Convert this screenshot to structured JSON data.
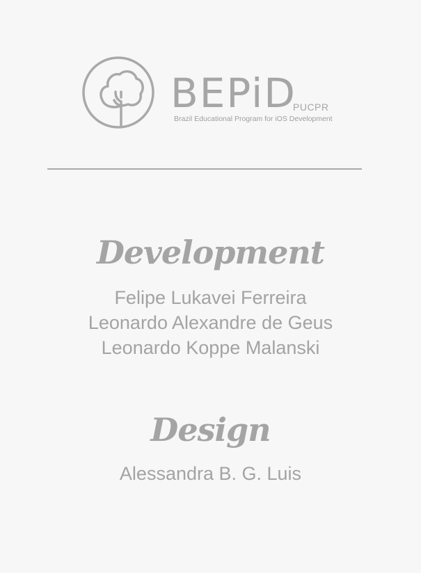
{
  "logo": {
    "icon": "tree-circle-icon",
    "name": "BEPiD",
    "suffix": "PUCPR",
    "tagline": "Brazil Educational Program for iOS Development"
  },
  "development": {
    "title": "Development",
    "members": [
      "Felipe Lukavei Ferreira",
      "Leonardo Alexandre de Geus",
      "Leonardo Koppe Malanski"
    ]
  },
  "design": {
    "title": "Design",
    "members": [
      "Alessandra B. G. Luis"
    ]
  },
  "colors": {
    "background": "#f7f7f7",
    "text": "#a6a6a6"
  }
}
